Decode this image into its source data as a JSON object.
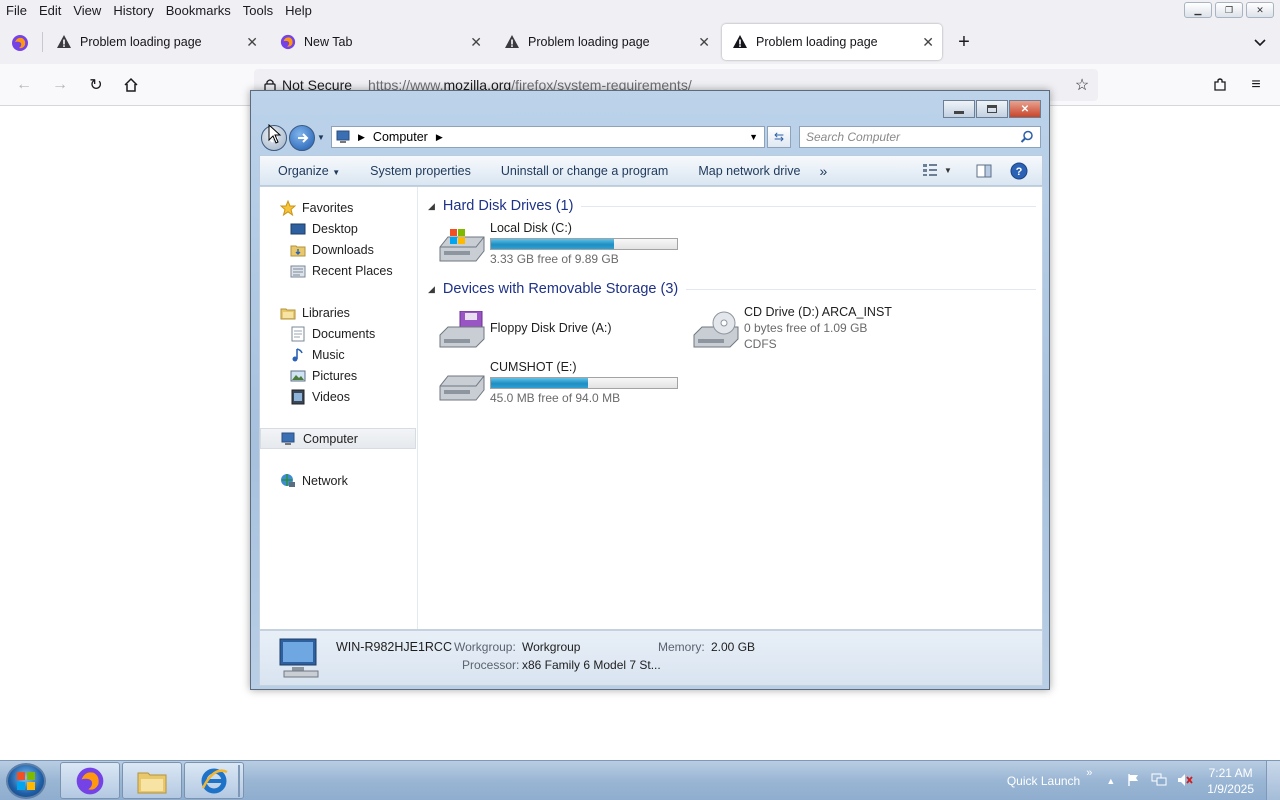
{
  "firefox": {
    "menu": [
      "File",
      "Edit",
      "View",
      "History",
      "Bookmarks",
      "Tools",
      "Help"
    ],
    "tabs": [
      {
        "label": "Problem loading page",
        "icon": "warning-icon"
      },
      {
        "label": "New Tab",
        "icon": "firefox-icon"
      },
      {
        "label": "Problem loading page",
        "icon": "warning-icon"
      },
      {
        "label": "Problem loading page",
        "icon": "warning-icon",
        "active": true
      }
    ],
    "urlbar": {
      "security": "Not Secure",
      "url_prefix": "https://www.",
      "url_domain": "mozilla.org",
      "url_path": "/firefox/system-requirements/"
    }
  },
  "explorer": {
    "address": "Computer",
    "search_placeholder": "Search Computer",
    "toolbar": {
      "organize": "Organize",
      "system_properties": "System properties",
      "uninstall": "Uninstall or change a program",
      "map_drive": "Map network drive",
      "more": "»"
    },
    "navpane": {
      "favorites": "Favorites",
      "desktop": "Desktop",
      "downloads": "Downloads",
      "recent": "Recent Places",
      "libraries": "Libraries",
      "documents": "Documents",
      "music": "Music",
      "pictures": "Pictures",
      "videos": "Videos",
      "computer": "Computer",
      "network": "Network"
    },
    "groups": {
      "hdd": "Hard Disk Drives (1)",
      "removable": "Devices with Removable Storage (3)"
    },
    "drives": {
      "c": {
        "name": "Local Disk (C:)",
        "free": "3.33 GB free of 9.89 GB",
        "used_fraction": 0.66
      },
      "a": {
        "name": "Floppy Disk Drive (A:)"
      },
      "d": {
        "name": "CD Drive (D:) ARCA_INST",
        "free": "0 bytes free of 1.09 GB",
        "fs": "CDFS"
      },
      "e": {
        "name": "CUMSHOT (E:)",
        "free": "45.0 MB free of 94.0 MB",
        "used_fraction": 0.52
      }
    },
    "details": {
      "computer_name": "WIN-R982HJE1RCC",
      "workgroup_label": "Workgroup:",
      "workgroup": "Workgroup",
      "memory_label": "Memory:",
      "memory": "2.00 GB",
      "processor_label": "Processor:",
      "processor": "x86 Family 6 Model 7 St..."
    }
  },
  "taskbar": {
    "quick_launch": "Quick Launch",
    "time": "7:21 AM",
    "date": "1/9/2025"
  }
}
